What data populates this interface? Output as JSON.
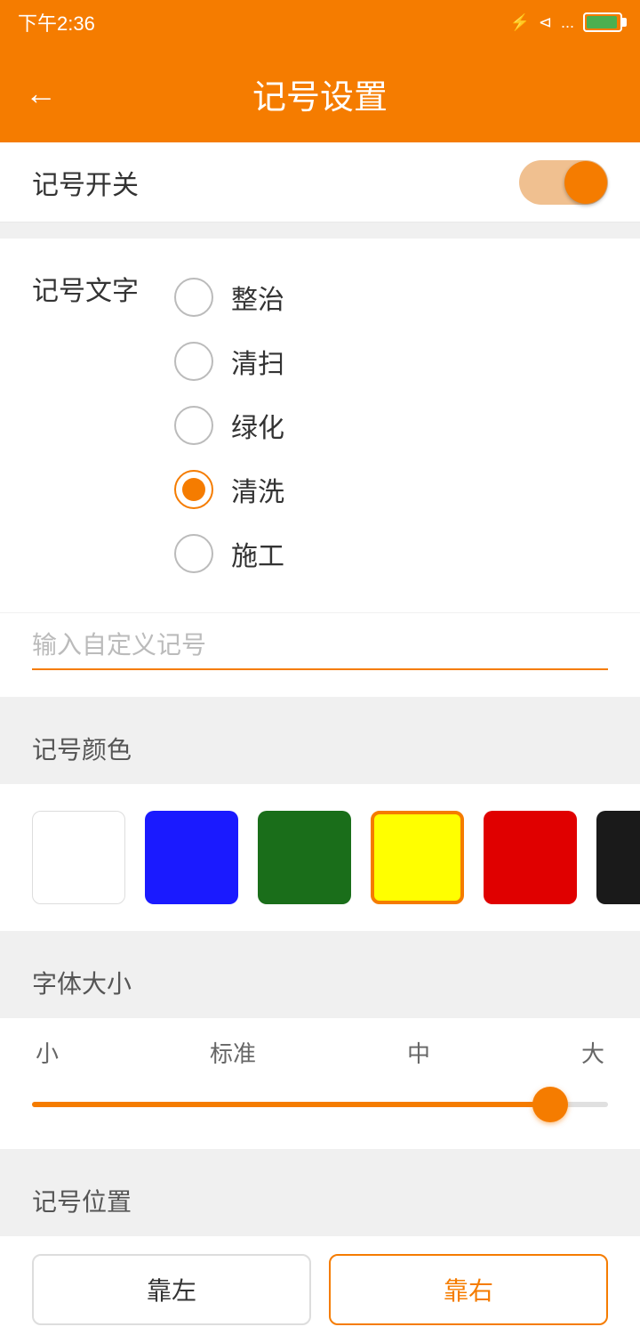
{
  "statusBar": {
    "time": "下午2:36",
    "icons": [
      "bluetooth",
      "mute",
      "wifi",
      "sim",
      "flash"
    ]
  },
  "appBar": {
    "title": "记号设置",
    "backIcon": "←"
  },
  "toggle": {
    "label": "记号开关",
    "isOn": true
  },
  "markText": {
    "label": "记号文字",
    "options": [
      {
        "id": "zhengzhi",
        "text": "整治",
        "selected": false
      },
      {
        "id": "qingsao",
        "text": "清扫",
        "selected": false
      },
      {
        "id": "lvhua",
        "text": "绿化",
        "selected": false
      },
      {
        "id": "qingxi",
        "text": "清洗",
        "selected": true
      },
      {
        "id": "shigong",
        "text": "施工",
        "selected": false
      }
    ],
    "customPlaceholder": "输入自定义记号"
  },
  "markColor": {
    "label": "记号颜色",
    "colors": [
      {
        "id": "white",
        "hex": "#ffffff",
        "selected": false,
        "isWhite": true
      },
      {
        "id": "blue",
        "hex": "#1a1aff",
        "selected": false
      },
      {
        "id": "green",
        "hex": "#1a6e1a",
        "selected": false
      },
      {
        "id": "yellow",
        "hex": "#ffff00",
        "selected": true
      },
      {
        "id": "red",
        "hex": "#e00000",
        "selected": false
      },
      {
        "id": "black",
        "hex": "#1a1a1a",
        "selected": false
      }
    ]
  },
  "fontSize": {
    "label": "字体大小",
    "sizes": [
      "小",
      "标准",
      "中",
      "大"
    ],
    "sliderPercent": 90
  },
  "markPosition": {
    "label": "记号位置",
    "options": [
      {
        "id": "top-left",
        "text": "靠左",
        "selected": false
      },
      {
        "id": "center",
        "text": "靠右",
        "selected": true
      }
    ]
  }
}
